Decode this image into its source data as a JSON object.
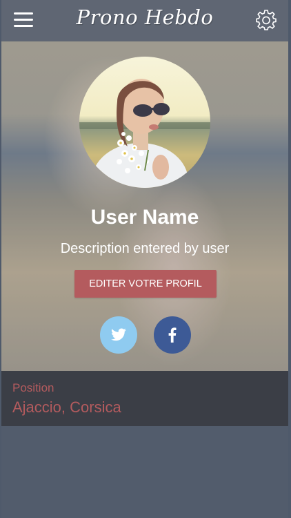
{
  "header": {
    "title": "Prono Hebdo",
    "menu_icon": "hamburger-menu-icon",
    "settings_icon": "gear-icon"
  },
  "profile": {
    "name": "User Name",
    "description": "Description entered by user",
    "edit_button_label": "EDITER VOTRE PROFIL",
    "social": [
      "twitter-icon",
      "facebook-icon"
    ]
  },
  "location": {
    "label": "Position",
    "value": "Ajaccio, Corsica"
  },
  "colors": {
    "header": "#5f6673",
    "accent": "#b45b5e",
    "twitter": "#8fcbf0",
    "facebook": "#3d5a96",
    "panel": "#3b3e46",
    "background": "#525c6c"
  }
}
